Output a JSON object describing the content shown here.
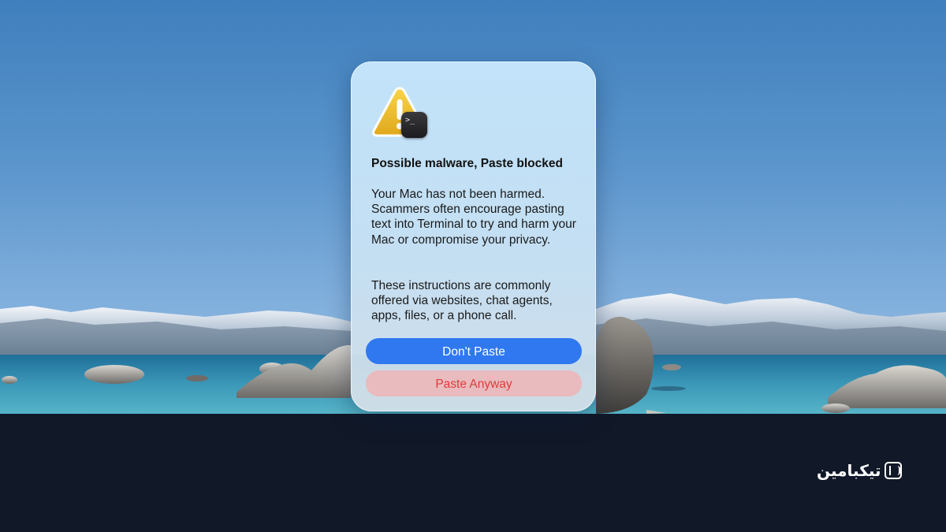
{
  "dialog": {
    "icon": "warning-triangle-icon",
    "badge_icon": "terminal-icon",
    "terminal_prompt": ">_",
    "title": "Possible malware, Paste blocked",
    "paragraph1": "Your Mac has not been harmed. Scammers often encourage pasting text into Terminal to try and harm your Mac or compromise your privacy.",
    "paragraph2": "These instructions are commonly offered via websites, chat agents, apps, files, or a phone call.",
    "primary_button": "Don't Paste",
    "secondary_button": "Paste Anyway"
  },
  "brand": {
    "logo_text": "تیکبامین"
  },
  "colors": {
    "primary_button": "#2f78f0",
    "danger_text": "#e23b3b",
    "footer_bg": "#111827"
  }
}
